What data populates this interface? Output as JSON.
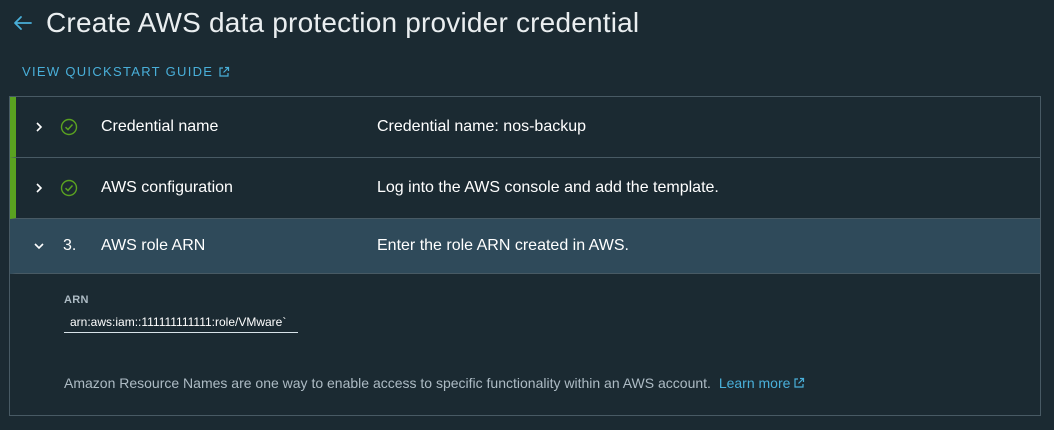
{
  "header": {
    "title": "Create AWS data protection provider credential",
    "back_icon": "arrow-left-icon"
  },
  "quickstart": {
    "label": "VIEW QUICKSTART GUIDE",
    "icon": "external-link-icon"
  },
  "colors": {
    "background": "#1b2a32",
    "accent_link": "#49afd9",
    "success": "#5aa220",
    "active_step_bg": "#2f4a5a",
    "border": "#485a64"
  },
  "steps": [
    {
      "status": "complete",
      "title": "Credential name",
      "summary": "Credential name: nos-backup",
      "expanded": false
    },
    {
      "status": "complete",
      "title": "AWS configuration",
      "summary": "Log into the AWS console and add the template.",
      "expanded": false
    },
    {
      "status": "active",
      "number": "3.",
      "title": "AWS role ARN",
      "summary": "Enter the role ARN created in AWS.",
      "expanded": true
    }
  ],
  "arn_field": {
    "label": "ARN",
    "value": "arn:aws:iam::111111111111:role/VMware`"
  },
  "helper": {
    "text": "Amazon Resource Names are one way to enable access to specific functionality within an AWS account.",
    "link_label": "Learn more"
  }
}
